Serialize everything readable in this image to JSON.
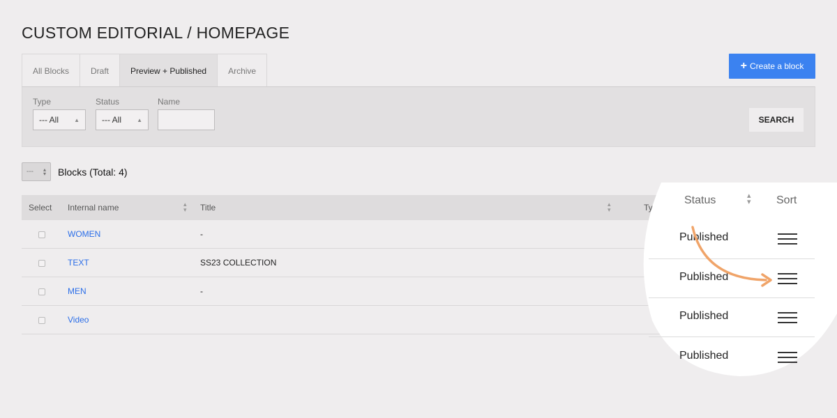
{
  "page_title": "CUSTOM EDITORIAL / HOMEPAGE",
  "tabs": [
    {
      "label": "All Blocks"
    },
    {
      "label": "Draft"
    },
    {
      "label": "Preview + Published"
    },
    {
      "label": "Archive"
    }
  ],
  "active_tab": "Preview + Published",
  "create_button": {
    "label": "Create a block"
  },
  "filters": {
    "type": {
      "label": "Type",
      "value": "--- All"
    },
    "status": {
      "label": "Status",
      "value": "--- All"
    },
    "name": {
      "label": "Name",
      "value": ""
    },
    "search_label": "SEARCH"
  },
  "blocks": {
    "per_page_value": "---",
    "title": "Blocks (Total: 4)"
  },
  "table": {
    "headers": {
      "select": "Select",
      "internal_name": "Internal name",
      "title": "Title",
      "type": "Type",
      "status": "Status",
      "sort": "Sort"
    },
    "rows": [
      {
        "internal_name": "WOMEN",
        "title": "-",
        "status": "Published"
      },
      {
        "internal_name": "TEXT",
        "title": "SS23 COLLECTION",
        "status": "Published"
      },
      {
        "internal_name": "MEN",
        "title": "-",
        "status": "Published"
      },
      {
        "internal_name": "Video",
        "title": "",
        "status": "Published"
      }
    ]
  },
  "colors": {
    "background": "#efedee",
    "accent_button": "#3b82f0",
    "link": "#2b6ee8",
    "drag_arrow": "#f0a469"
  },
  "icons": {
    "create": "plus-icon",
    "sort_handle": "drag-handle-icon",
    "sort_arrows": "sort-arrows-icon",
    "annotation": "curved-arrow-icon"
  }
}
